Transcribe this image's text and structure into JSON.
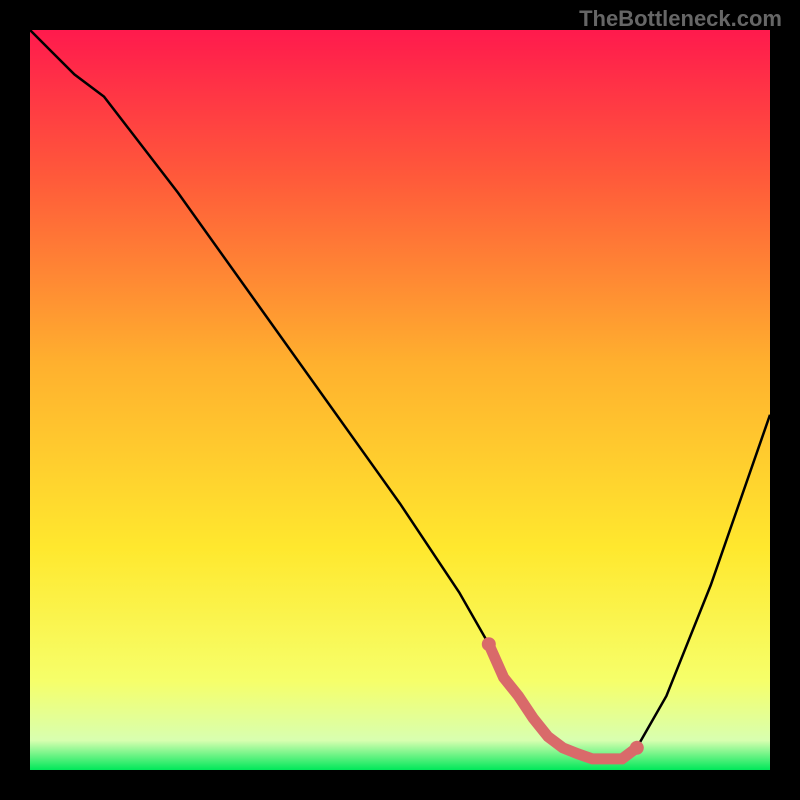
{
  "watermark": "TheBottleneck.com",
  "chart_data": {
    "type": "line",
    "title": "",
    "xlabel": "",
    "ylabel": "",
    "xlim": [
      0,
      100
    ],
    "ylim": [
      0,
      100
    ],
    "background_gradient": {
      "stops": [
        {
          "offset": 0,
          "color": "#ff1a4d"
        },
        {
          "offset": 20,
          "color": "#ff5a3a"
        },
        {
          "offset": 45,
          "color": "#ffb02e"
        },
        {
          "offset": 70,
          "color": "#ffe82e"
        },
        {
          "offset": 88,
          "color": "#f6ff6a"
        },
        {
          "offset": 96,
          "color": "#d8ffb0"
        },
        {
          "offset": 100,
          "color": "#00e85a"
        }
      ]
    },
    "series": [
      {
        "name": "bottleneck-curve",
        "color": "#000000",
        "x": [
          0,
          3,
          6,
          10,
          20,
          30,
          40,
          50,
          58,
          62,
          66,
          71,
          76,
          80,
          82,
          86,
          92,
          100
        ],
        "y": [
          100,
          97,
          94,
          91,
          78,
          64,
          50,
          36,
          24,
          17,
          10,
          3.5,
          1.5,
          1.5,
          3,
          10,
          25,
          48
        ]
      }
    ],
    "highlight": {
      "name": "optimal-range",
      "color": "#d96a6a",
      "x": [
        62,
        64,
        66,
        68,
        70,
        72,
        74,
        76,
        78,
        80,
        82
      ],
      "y": [
        17,
        12.5,
        10,
        7,
        4.5,
        3,
        2.2,
        1.5,
        1.5,
        1.5,
        3
      ]
    }
  }
}
